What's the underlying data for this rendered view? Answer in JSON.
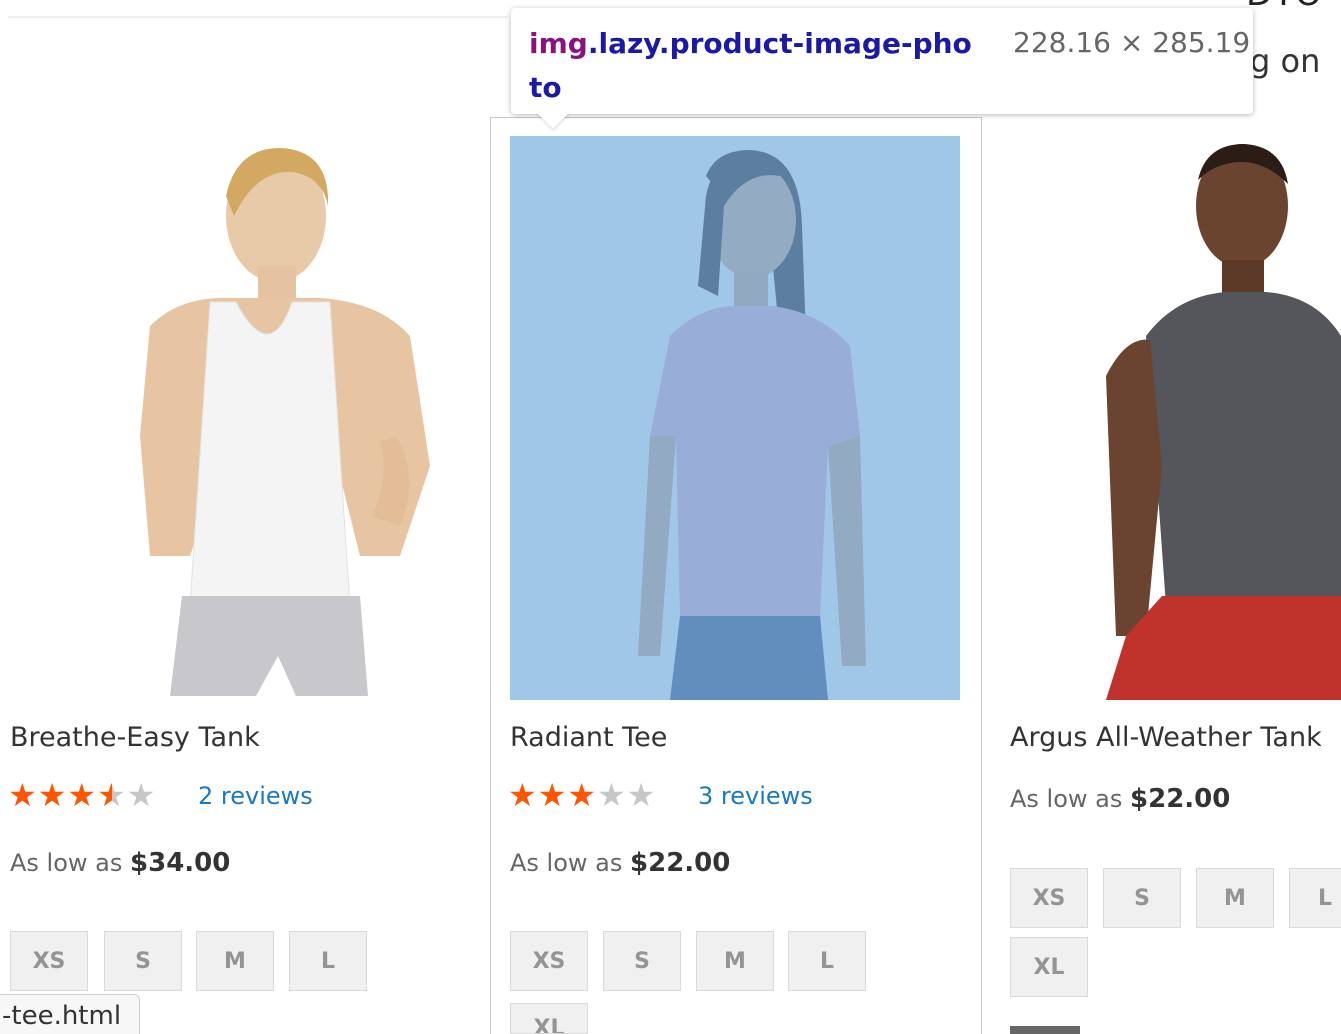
{
  "inspector_tooltip": {
    "selector_tag": "img",
    "selector_classes": ".lazy.product-image-photo",
    "dimensions": "228.16 × 285.19"
  },
  "page_clipped_text": {
    "heading": "DTO",
    "line": "g on"
  },
  "products": [
    {
      "name": "Breathe-Easy Tank",
      "rating_percent": 70,
      "stars": {
        "full": "★★★",
        "half": "★",
        "empty": "★"
      },
      "reviews": "2 reviews",
      "price_prefix": "As low as",
      "price": "$34.00",
      "sizes": [
        "XS",
        "S",
        "M",
        "L"
      ]
    },
    {
      "name": "Radiant Tee",
      "rating_percent": 60,
      "stars": {
        "full": "★★★",
        "empty": "★★"
      },
      "reviews": "3 reviews",
      "price_prefix": "As low as",
      "price": "$22.00",
      "sizes": [
        "XS",
        "S",
        "M",
        "L",
        "XL"
      ]
    },
    {
      "name": "Argus All-Weather Tank",
      "price_prefix": "As low as",
      "price": "$22.00",
      "sizes": [
        "XS",
        "S",
        "M",
        "L",
        "XL"
      ]
    }
  ],
  "status_bar": {
    "url": "-tee.html"
  },
  "colors": {
    "star_on": "#ff5501",
    "star_off": "#c7c7c7",
    "link": "#1979c3",
    "highlight": "#6fa8dc"
  }
}
